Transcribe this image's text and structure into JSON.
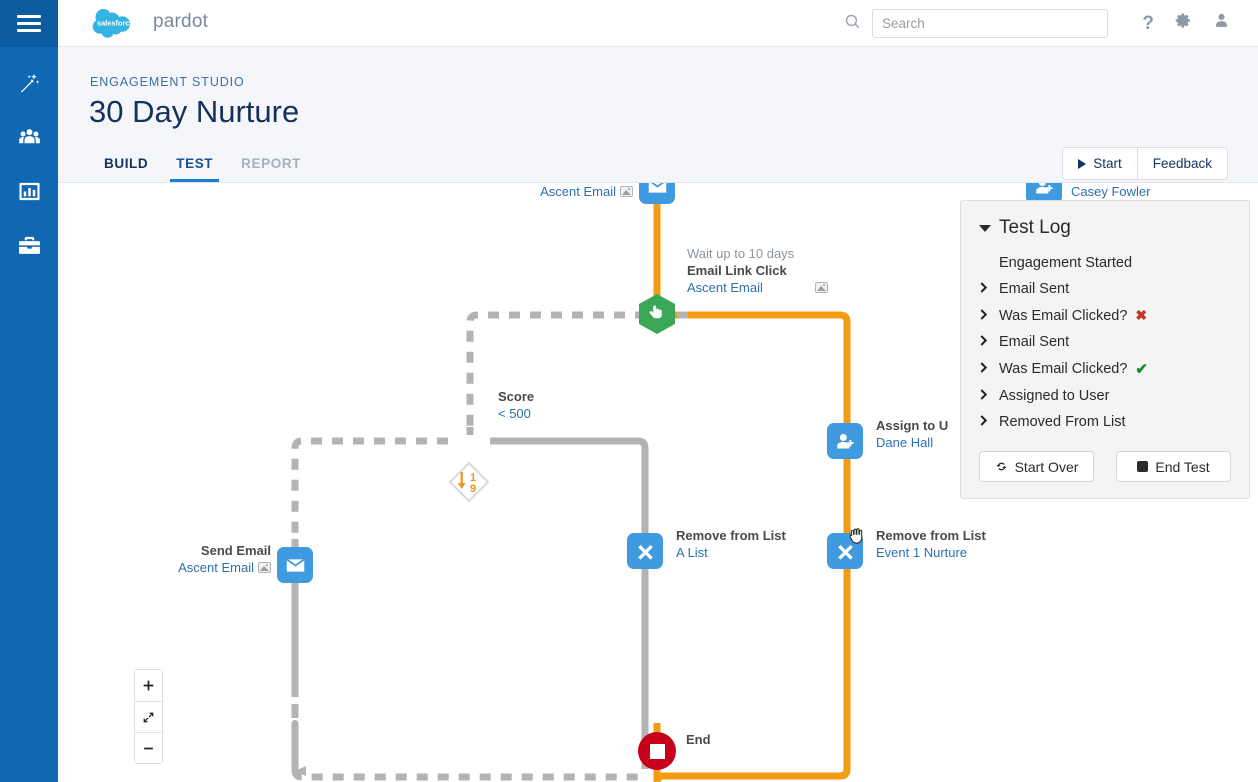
{
  "rail": {
    "menu_icon": "hamburger-icon",
    "items": [
      {
        "name": "automation",
        "icon": "magic-wand-icon"
      },
      {
        "name": "prospects",
        "icon": "people-group-icon"
      },
      {
        "name": "reports",
        "icon": "bar-chart-icon"
      },
      {
        "name": "admin",
        "icon": "briefcase-icon"
      }
    ]
  },
  "topbar": {
    "brand_mark": "salesforce",
    "brand_word": "pardot",
    "search": {
      "placeholder": "Search",
      "value": "",
      "icon": "search-icon"
    },
    "help_icon": "question-mark-icon",
    "settings_icon": "gear-icon",
    "user_icon": "user-avatar-icon"
  },
  "page": {
    "eyebrow": "ENGAGEMENT STUDIO",
    "title": "30 Day Nurture",
    "tabs": [
      {
        "label": "BUILD",
        "state": "normal"
      },
      {
        "label": "TEST",
        "state": "active"
      },
      {
        "label": "REPORT",
        "state": "muted"
      }
    ],
    "actions": [
      {
        "label": "Start",
        "icon": "play-icon"
      },
      {
        "label": "Feedback",
        "icon": ""
      }
    ]
  },
  "canvas": {
    "nodes": [
      {
        "id": "send-email-top",
        "type": "email",
        "title": "",
        "subtitle": "Ascent Email",
        "has_image_icon": true,
        "label_side": "left"
      },
      {
        "id": "add-to-list-top",
        "type": "add-to-list",
        "title": "",
        "subtitle": "Casey Fowler",
        "has_image_icon": false,
        "label_side": "right"
      },
      {
        "id": "email-link-click",
        "type": "trigger-hex",
        "wait": "Wait up to 10 days",
        "title": "Email Link Click",
        "subtitle": "Ascent Email",
        "has_image_icon": true,
        "label_side": "right"
      },
      {
        "id": "score-rule",
        "type": "score-diamond",
        "title": "Score",
        "subtitle": "< 500",
        "label_side": "right",
        "badge_top": "1",
        "badge_bottom": "9"
      },
      {
        "id": "assign-to-user",
        "type": "assign-user",
        "title": "Assign to U",
        "subtitle": "Dane Hall",
        "label_side": "right"
      },
      {
        "id": "send-email-left",
        "type": "email",
        "title": "Send Email",
        "subtitle": "Ascent Email",
        "has_image_icon": true,
        "label_side": "left"
      },
      {
        "id": "remove-from-list-a",
        "type": "remove-from-list",
        "title": "Remove from List",
        "subtitle": "A List",
        "label_side": "right"
      },
      {
        "id": "remove-from-list-b",
        "type": "remove-from-list",
        "title": "Remove from List",
        "subtitle": "Event 1 Nurture",
        "label_side": "right"
      },
      {
        "id": "end",
        "type": "end",
        "title": "End",
        "subtitle": "",
        "label_side": "right"
      }
    ],
    "zoom_controls": [
      {
        "name": "zoom-in",
        "glyph": "+"
      },
      {
        "name": "fit-to-screen",
        "glyph": "fit"
      },
      {
        "name": "zoom-out",
        "glyph": "–"
      }
    ],
    "cursor": "grab-hand-cursor",
    "colors": {
      "active_path": "#f39c12",
      "inactive_path": "#b3b3b3",
      "node_blue": "#3f9ae0",
      "trigger_green": "#3aa757",
      "end_red": "#c9001b"
    }
  },
  "test_log": {
    "title": "Test Log",
    "collapse_icon": "caret-down-icon",
    "entries": [
      {
        "label": "Engagement Started",
        "expandable": false,
        "status": ""
      },
      {
        "label": "Email Sent",
        "expandable": true,
        "status": ""
      },
      {
        "label": "Was Email Clicked?",
        "expandable": true,
        "status": "fail"
      },
      {
        "label": "Email Sent",
        "expandable": true,
        "status": ""
      },
      {
        "label": "Was Email Clicked?",
        "expandable": true,
        "status": "pass"
      },
      {
        "label": "Assigned to User",
        "expandable": true,
        "status": ""
      },
      {
        "label": "Removed From List",
        "expandable": true,
        "status": ""
      }
    ],
    "status_glyphs": {
      "fail": "✖",
      "pass": "✔"
    },
    "buttons": [
      {
        "label": "Start Over",
        "icon": "refresh-icon"
      },
      {
        "label": "End Test",
        "icon": "stop-square-icon"
      }
    ]
  }
}
